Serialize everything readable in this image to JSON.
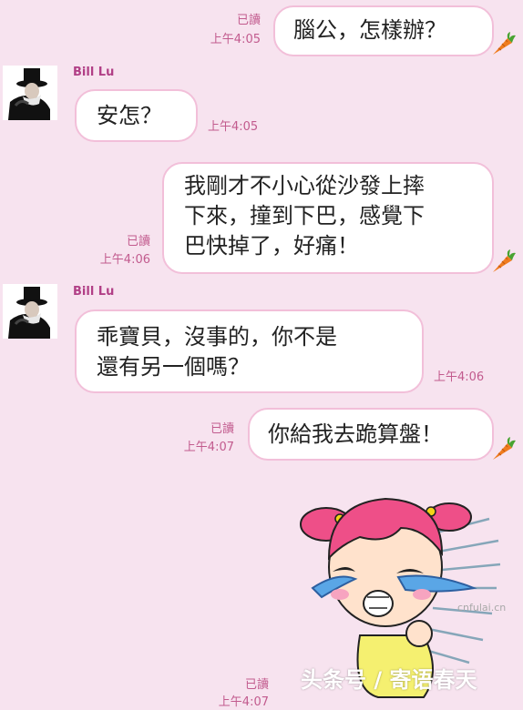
{
  "messages": [
    {
      "text": "腦公，怎樣辦？",
      "read": "已讀",
      "time": "上午4:05"
    },
    {
      "sender": "Bill Lu",
      "text": "安怎？",
      "time": "上午4:05"
    },
    {
      "text": "我剛才不小心從沙發上摔\n下來，撞到下巴，感覺下\n巴快掉了，好痛！",
      "read": "已讀",
      "time": "上午4:06"
    },
    {
      "sender": "Bill Lu",
      "text": "乖寶貝，沒事的，你不是\n還有另一個嗎？",
      "time": "上午4:06"
    },
    {
      "text": "你給我去跪算盤！",
      "read": "已讀",
      "time": "上午4:07"
    }
  ],
  "last_read": "已讀",
  "last_time": "上午4:07",
  "watermark_site": "cnfulai.cn",
  "watermark_source": "头条号 / 寄语春天",
  "colors": {
    "background": "#f7e3ef",
    "bubble_border": "#f2bfd9",
    "meta": "#c25b8e",
    "sender": "#b13f86",
    "carrot": "#f07c1f"
  }
}
